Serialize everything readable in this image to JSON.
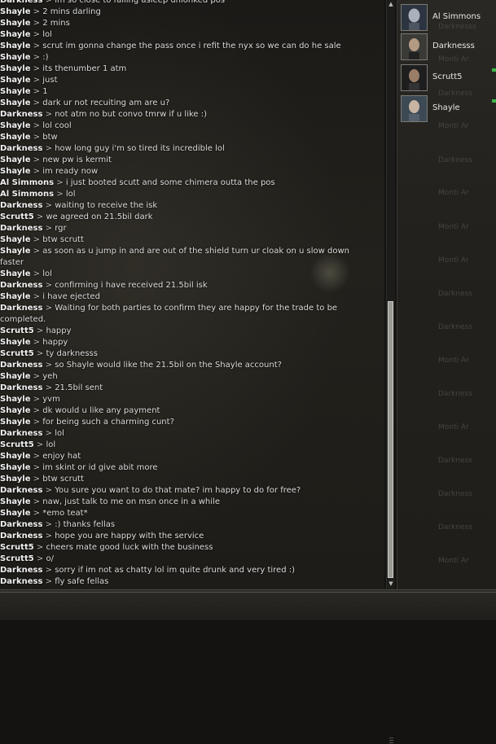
{
  "chat": {
    "messages": [
      {
        "sender": "Darkness",
        "text": "im so close to falling asleep unlonked pos"
      },
      {
        "sender": "Shayle",
        "text": "2 mins darling"
      },
      {
        "sender": "Shayle",
        "text": "2 mins"
      },
      {
        "sender": "Shayle",
        "text": "lol"
      },
      {
        "sender": "Shayle",
        "text": "scrut im gonna change the pass once i refit the nyx so we can do he sale"
      },
      {
        "sender": "Shayle",
        "text": ":)"
      },
      {
        "sender": "Shayle",
        "text": "its thenumber 1 atm"
      },
      {
        "sender": "Shayle",
        "text": "just"
      },
      {
        "sender": "Shayle",
        "text": "1"
      },
      {
        "sender": "Shayle",
        "text": "dark ur not recuiting am are u?"
      },
      {
        "sender": "Darkness",
        "text": "not atm no but convo tmrw if u like :)"
      },
      {
        "sender": "Shayle",
        "text": "lol cool"
      },
      {
        "sender": "Shayle",
        "text": "btw"
      },
      {
        "sender": "Darkness",
        "text": "how long guy i'm so tired its incredible lol"
      },
      {
        "sender": "Shayle",
        "text": "new pw is kermit"
      },
      {
        "sender": "Shayle",
        "text": "im ready now"
      },
      {
        "sender": "Al Simmons",
        "text": "i just booted scutt and some chimera outta the pos"
      },
      {
        "sender": "Al Simmons",
        "text": "lol"
      },
      {
        "sender": "Darkness",
        "text": "waiting to receive the isk"
      },
      {
        "sender": "Scrutt5",
        "text": "we agreed on 21.5bil dark"
      },
      {
        "sender": "Darkness",
        "text": "rgr"
      },
      {
        "sender": "Shayle",
        "text": "btw scrutt"
      },
      {
        "sender": "Shayle",
        "text": "as soon as u jump in and are out of the shield turn ur cloak on u slow down faster"
      },
      {
        "sender": "Shayle",
        "text": "lol"
      },
      {
        "sender": "Darkness",
        "text": "confirming i have received 21.5bil isk"
      },
      {
        "sender": "Shayle",
        "text": "i have ejected"
      },
      {
        "sender": "Darkness",
        "text": "Waiting for both parties to confirm they are happy for the trade to be completed."
      },
      {
        "sender": "Scrutt5",
        "text": "happy"
      },
      {
        "sender": "Shayle",
        "text": "happy"
      },
      {
        "sender": "Scrutt5",
        "text": "ty darknesss"
      },
      {
        "sender": "Darkness",
        "text": "so Shayle would like the 21.5bil on the Shayle account?"
      },
      {
        "sender": "Shayle",
        "text": "yeh"
      },
      {
        "sender": "Darkness",
        "text": "21.5bil sent"
      },
      {
        "sender": "Shayle",
        "text": "yvm"
      },
      {
        "sender": "Shayle",
        "text": "dk would u like any payment"
      },
      {
        "sender": "Shayle",
        "text": "for being such a charming cunt?"
      },
      {
        "sender": "Darkness",
        "text": "lol"
      },
      {
        "sender": "Scrutt5",
        "text": "lol"
      },
      {
        "sender": "Shayle",
        "text": "enjoy hat"
      },
      {
        "sender": "Shayle",
        "text": "im skint or id give abit more"
      },
      {
        "sender": "Shayle",
        "text": "btw scrutt"
      },
      {
        "sender": "Darkness",
        "text": "You sure you want to do that mate? im happy to do for free?"
      },
      {
        "sender": "Shayle",
        "text": "naw, just talk to me on msn once in a while"
      },
      {
        "sender": "Shayle",
        "text": "*emo teat*"
      },
      {
        "sender": "Darkness",
        "text": ":) thanks fellas"
      },
      {
        "sender": "Darkness",
        "text": "hope you are happy with the service"
      },
      {
        "sender": "Scrutt5",
        "text": "cheers mate good luck with the business"
      },
      {
        "sender": "Scrutt5",
        "text": "o/"
      },
      {
        "sender": "Darkness",
        "text": "sorry if im not as chatty lol im quite drunk and very tired :)"
      },
      {
        "sender": "Darkness",
        "text": "fly safe fellas"
      }
    ]
  },
  "members": [
    {
      "name": "Al Simmons",
      "portrait": "pilot-portrait-icon",
      "online": false
    },
    {
      "name": "Darknesss",
      "portrait": "pilot-portrait-icon",
      "online": false
    },
    {
      "name": "Scrutt5",
      "portrait": "pilot-portrait-icon",
      "online": true
    },
    {
      "name": "Shayle",
      "portrait": "pilot-portrait-icon",
      "online": true
    }
  ],
  "scrollbar": {
    "up_icon": "▲",
    "down_icon": "▼"
  },
  "colors": {
    "online_indicator": "#3cb44a",
    "background": "#1b1a17"
  }
}
